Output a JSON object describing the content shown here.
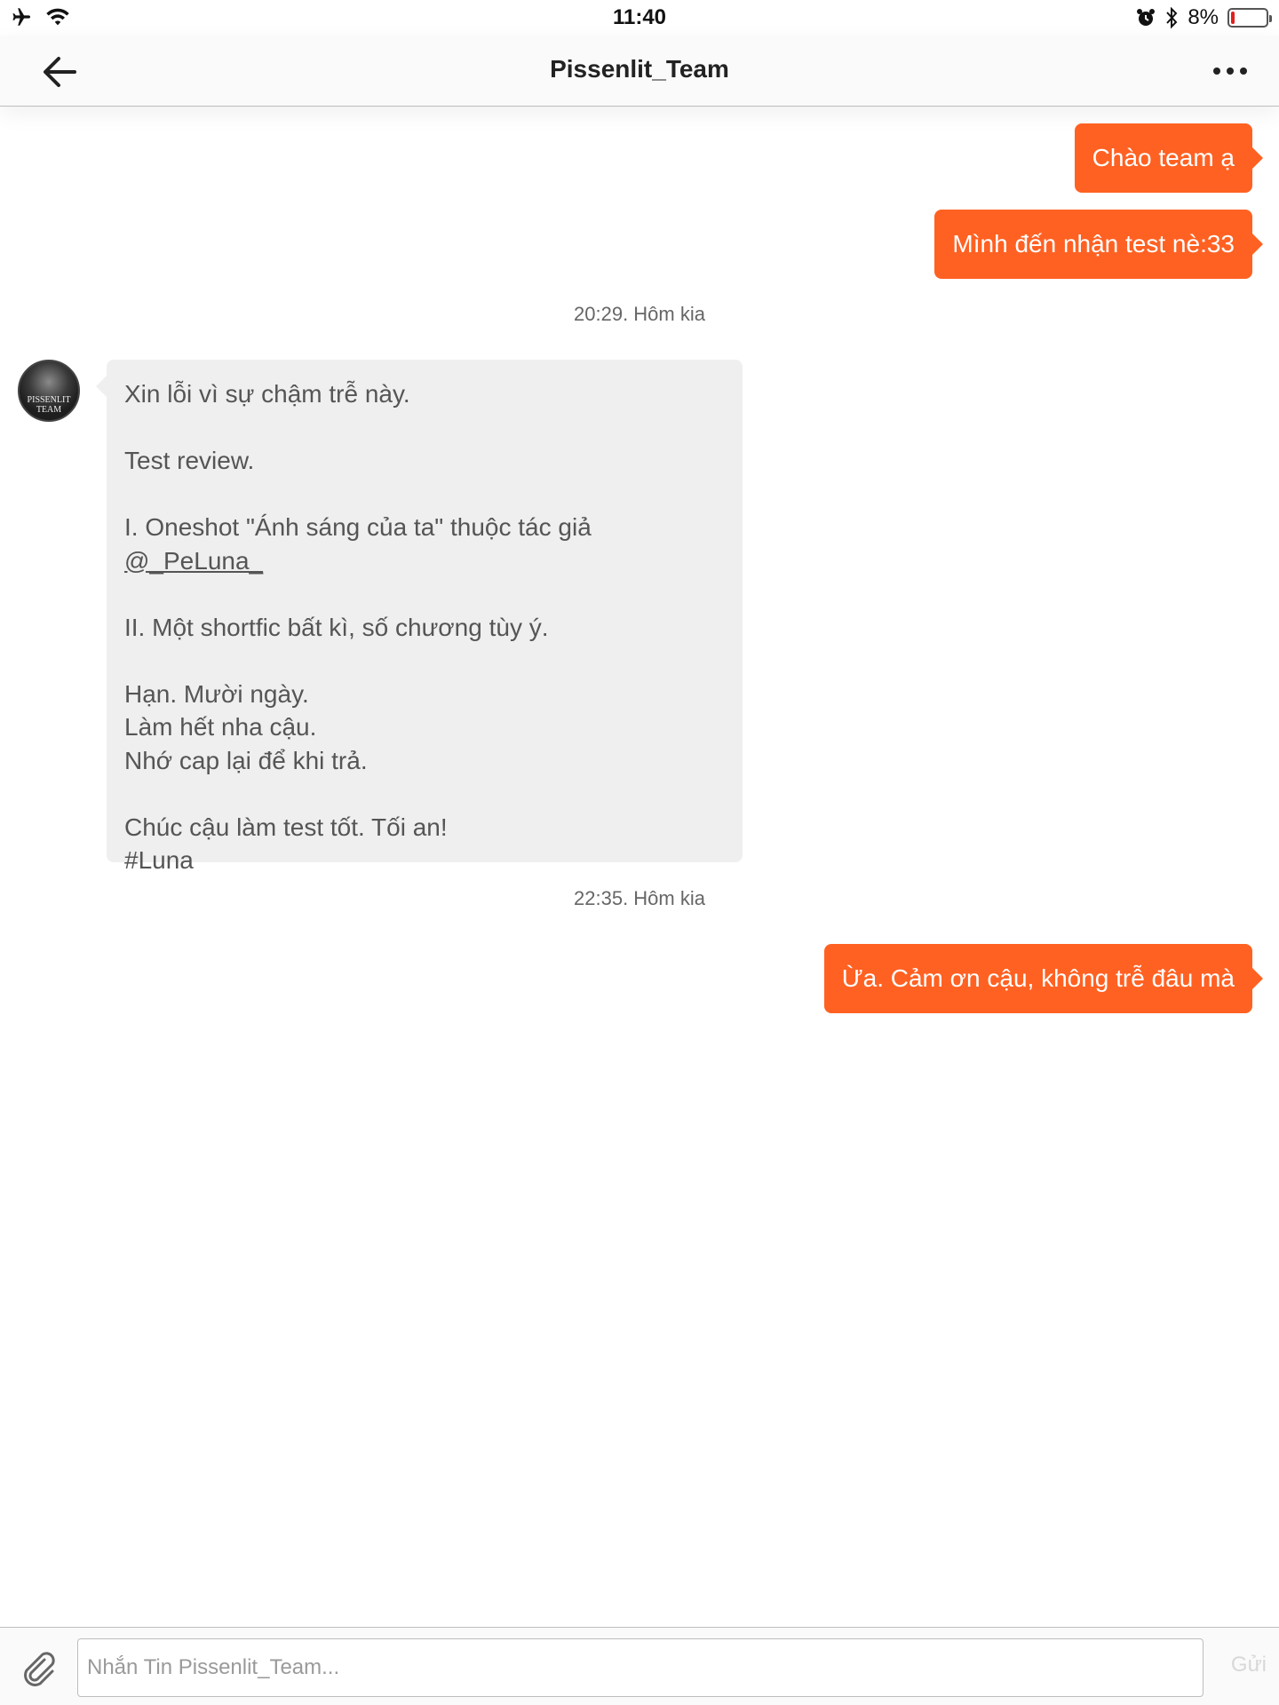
{
  "status_bar": {
    "time": "11:40",
    "battery_percent": "8%",
    "battery_level": 0.08,
    "icons": [
      "airplane-icon",
      "wifi-icon",
      "alarm-icon",
      "bluetooth-icon",
      "battery-icon"
    ]
  },
  "header": {
    "title": "Pissenlit_Team",
    "back_icon": "arrow-left-icon",
    "more_icon": "more-dots-icon"
  },
  "messages": {
    "out1": "Chào team ạ",
    "out2": "Mình đến nhận test nè:33",
    "time1": "20:29. Hôm kia",
    "in_lines": {
      "l1": "Xin lỗi vì sự chậm trễ này.",
      "l2": "Test review.",
      "l3_prefix": "I. Oneshot \"Ánh sáng của ta\" thuộc tác giả ",
      "l3_mention": "@_PeLuna_",
      "l4": "II. Một shortfic bất kì, số chương tùy ý.",
      "l5": "Hạn. Mười ngày.",
      "l6": "Làm hết nha cậu.",
      "l7": "Nhớ cap lại để khi trả.",
      "l8": "Chúc cậu làm test tốt. Tối an!",
      "l9": "#Luna"
    },
    "avatar_text_1": "PISSENLIT",
    "avatar_text_2": "TEAM",
    "time2": "22:35. Hôm kia",
    "out3": "Ừa. Cảm ơn cậu, không trễ đâu mà"
  },
  "composer": {
    "placeholder": "Nhắn Tin Pissenlit_Team...",
    "value": "",
    "send_label": "Gửi",
    "attach_icon": "paperclip-icon"
  },
  "colors": {
    "accent": "#ff6122",
    "incoming_bubble": "#efefef",
    "battery_low": "#e02020"
  }
}
